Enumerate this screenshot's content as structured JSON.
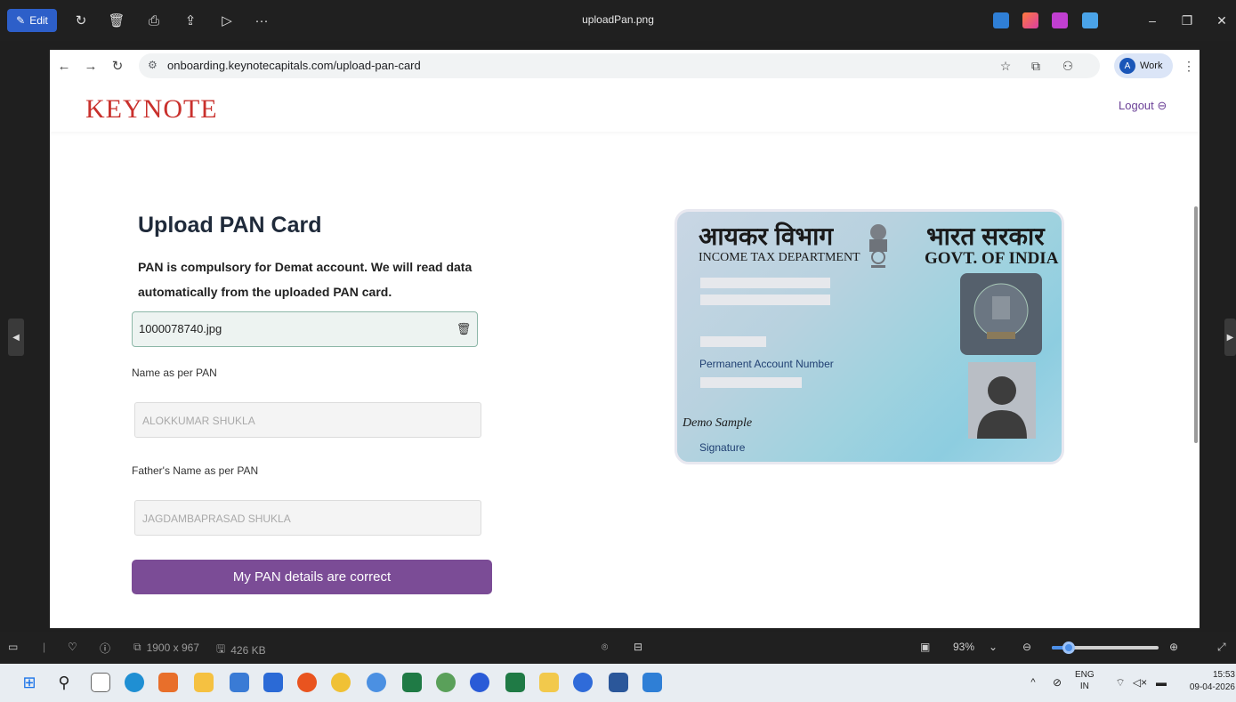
{
  "photos_app": {
    "edit_label": "Edit",
    "file_title": "uploadPan.png",
    "toolbar_icons": [
      "rotate-icon",
      "delete-icon",
      "print-icon",
      "share-icon",
      "slideshow-icon",
      "more-icon"
    ],
    "window_controls": [
      "minimize-icon",
      "restore-icon",
      "close-icon"
    ]
  },
  "browser": {
    "url": "onboarding.keynotecapitals.com/upload-pan-card",
    "profile_initial": "A",
    "profile_label": "Work"
  },
  "site": {
    "logo": "KEYNOTE",
    "logout_label": "Logout",
    "logout_icon": "⊖",
    "brand_color": "#7b4c96",
    "logo_color": "#c9302c"
  },
  "upload_form": {
    "title": "Upload PAN Card",
    "description": "PAN is compulsory for Demat account. We will read data automatically from the uploaded PAN card.",
    "file_name": "1000078740.jpg",
    "name_label": "Name as per PAN",
    "name_value": "ALOKKUMAR SHUKLA",
    "father_label": "Father's Name as per PAN",
    "father_value": "JAGDAMBAPRASAD SHUKLA",
    "confirm_label": "My PAN details are correct"
  },
  "pan_card": {
    "hindi_dept": "आयकर विभाग",
    "english_dept": "INCOME TAX DEPARTMENT",
    "hindi_govt": "भारत सरकार",
    "english_govt": "GOVT. OF INDIA",
    "pan_label": "Permanent Account Number",
    "signature_sample": "Demo Sample",
    "signature_label": "Signature",
    "hologram_text": "आयकर विभाग"
  },
  "status_bar": {
    "dimensions": "1900 x 967",
    "file_size": "426 KB",
    "zoom": "93%",
    "zoom_level_fraction": 0.16
  },
  "taskbar": {
    "lang_top": "ENG",
    "lang_bottom": "IN",
    "time": "15:53",
    "date": "09-04-2026"
  }
}
